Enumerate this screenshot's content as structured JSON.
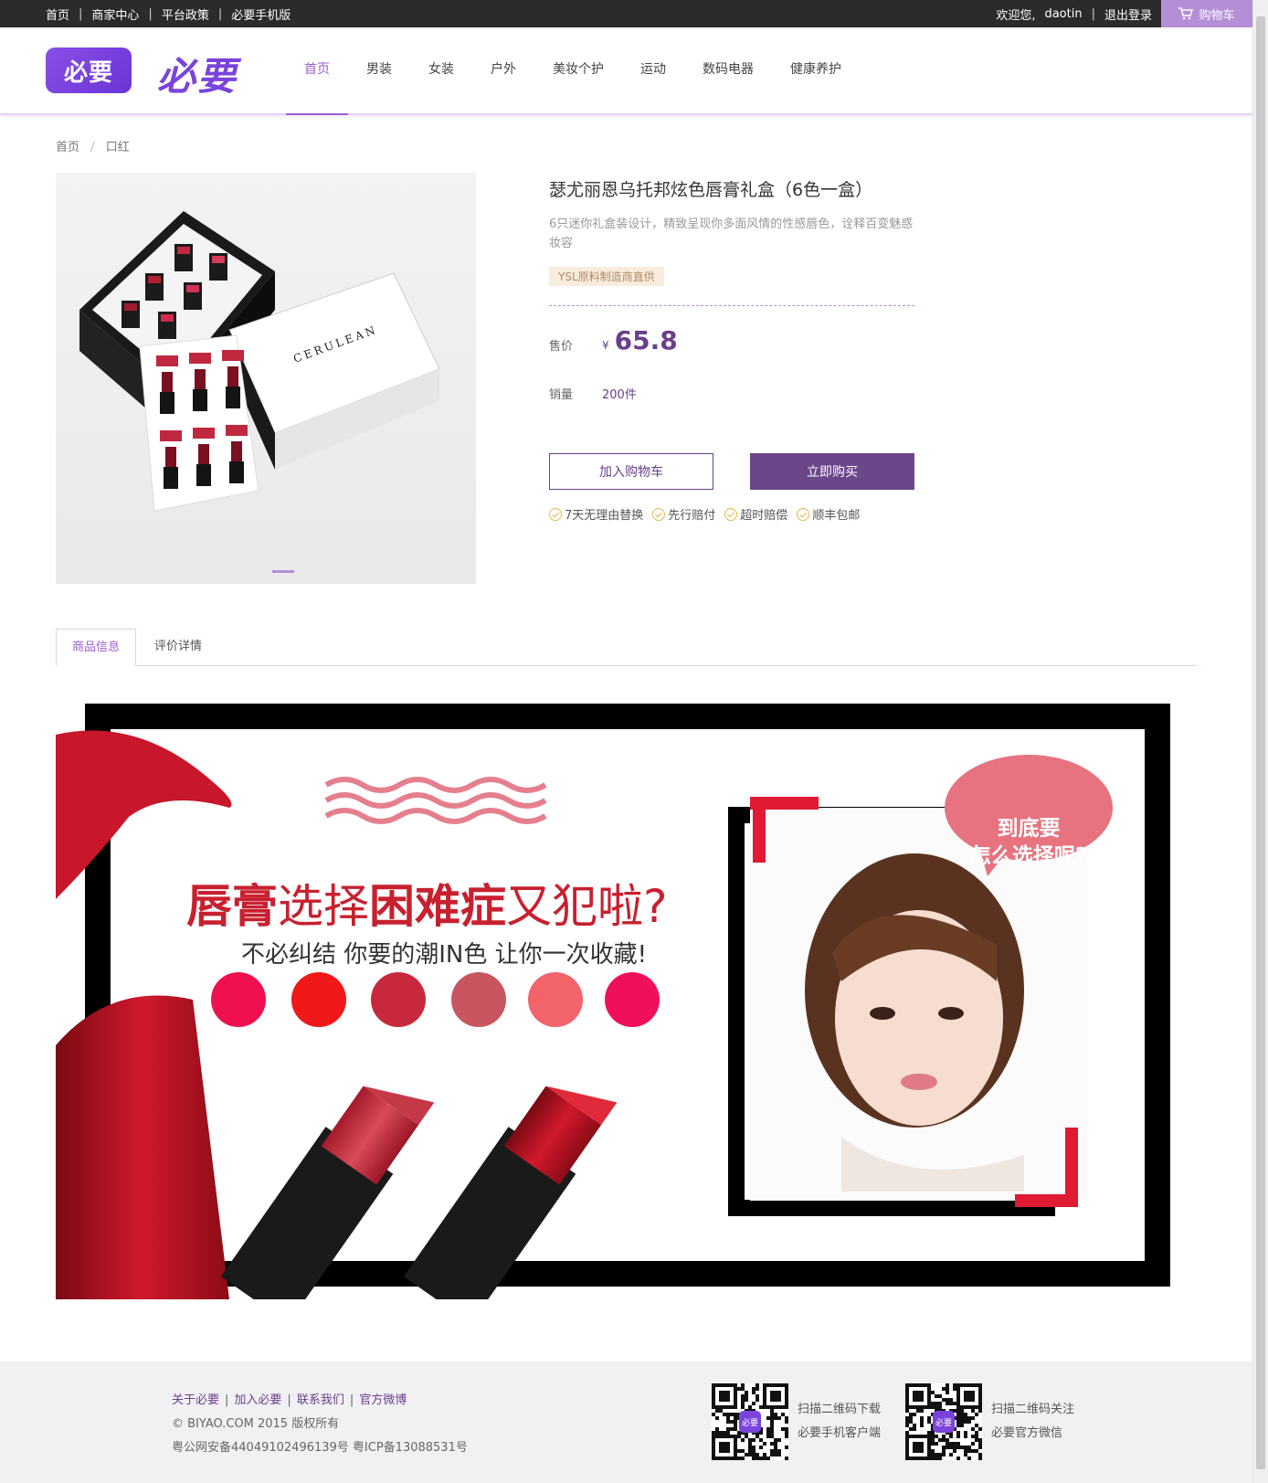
{
  "topbar": {
    "links": [
      "首页",
      "商家中心",
      "平台政策",
      "必要手机版"
    ],
    "welcome": "欢迎您,",
    "username": "daotin",
    "logout": "退出登录",
    "cart": "购物车"
  },
  "header": {
    "logo_badge": "必要",
    "logo_text": "必要",
    "nav": [
      "首页",
      "男装",
      "女装",
      "户外",
      "美妆个护",
      "运动",
      "数码电器",
      "健康养护"
    ],
    "active_nav": "首页"
  },
  "breadcrumb": [
    "首页",
    "口红"
  ],
  "product": {
    "title": "瑟尤丽恩乌托邦炫色唇膏礼盒（6色一盒）",
    "description": "6只迷你礼盒装设计，精致呈现你多面风情的性感唇色，诠释百变魅惑妆容",
    "tag": "YSL原料制造商直供",
    "price_label": "售价",
    "currency": "¥",
    "price": "65.8",
    "sales_label": "销量",
    "sales": "200件",
    "add_to_cart": "加入购物车",
    "buy_now": "立即购买",
    "guarantees": [
      "7天无理由替换",
      "先行赔付",
      "超时赔偿",
      "顺丰包邮"
    ],
    "image_brand_text": "CERULEAN",
    "lipstick_swatch_colors": [
      "#c0283f",
      "#d83b5a",
      "#b0202f",
      "#cf3353",
      "#9e1c2c",
      "#d12a48"
    ]
  },
  "tabs": [
    "商品信息",
    "评价详情"
  ],
  "active_tab": "商品信息",
  "banner": {
    "headline_parts": [
      {
        "text": "唇膏",
        "bold": true
      },
      {
        "text": "选择",
        "bold": false
      },
      {
        "text": "困难症",
        "bold": true
      },
      {
        "text": "又犯啦?",
        "bold": false
      }
    ],
    "subline": "不必纠结 你要的潮IN色 让你一次收藏!",
    "bubble_line1": "到底要",
    "bubble_line2": "怎么选择呢?",
    "color_dots": [
      "#f0104f",
      "#f01818",
      "#c7283c",
      "#c85560",
      "#f2636a",
      "#f0105a"
    ]
  },
  "footer": {
    "links": [
      "关于必要",
      "加入必要",
      "联系我们",
      "官方微博"
    ],
    "copyright": "© BIYAO.COM 2015 版权所有",
    "icp": "粤公网安备44049102496139号 粤ICP备13088531号",
    "qr1_line1": "扫描二维码下载",
    "qr1_line2": "必要手机客户端",
    "qr2_line1": "扫描二维码关注",
    "qr2_line2": "必要官方微信",
    "qr_badge": "必要"
  },
  "colors": {
    "accent": "#9a5fcf",
    "brand_dark": "#6b4689",
    "cart": "#b58fd6"
  }
}
